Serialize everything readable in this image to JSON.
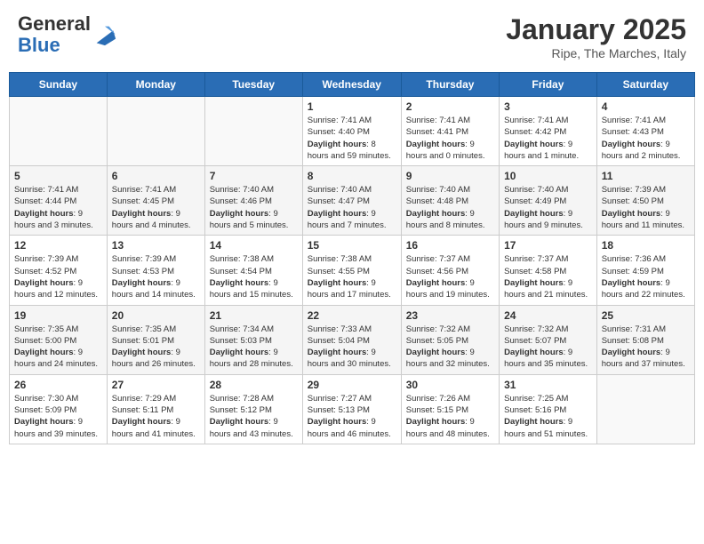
{
  "header": {
    "logo_general": "General",
    "logo_blue": "Blue",
    "month_title": "January 2025",
    "location": "Ripe, The Marches, Italy"
  },
  "days_of_week": [
    "Sunday",
    "Monday",
    "Tuesday",
    "Wednesday",
    "Thursday",
    "Friday",
    "Saturday"
  ],
  "weeks": [
    [
      {
        "day": "",
        "info": ""
      },
      {
        "day": "",
        "info": ""
      },
      {
        "day": "",
        "info": ""
      },
      {
        "day": "1",
        "info": "Sunrise: 7:41 AM\nSunset: 4:40 PM\nDaylight: 8 hours and 59 minutes."
      },
      {
        "day": "2",
        "info": "Sunrise: 7:41 AM\nSunset: 4:41 PM\nDaylight: 9 hours and 0 minutes."
      },
      {
        "day": "3",
        "info": "Sunrise: 7:41 AM\nSunset: 4:42 PM\nDaylight: 9 hours and 1 minute."
      },
      {
        "day": "4",
        "info": "Sunrise: 7:41 AM\nSunset: 4:43 PM\nDaylight: 9 hours and 2 minutes."
      }
    ],
    [
      {
        "day": "5",
        "info": "Sunrise: 7:41 AM\nSunset: 4:44 PM\nDaylight: 9 hours and 3 minutes."
      },
      {
        "day": "6",
        "info": "Sunrise: 7:41 AM\nSunset: 4:45 PM\nDaylight: 9 hours and 4 minutes."
      },
      {
        "day": "7",
        "info": "Sunrise: 7:40 AM\nSunset: 4:46 PM\nDaylight: 9 hours and 5 minutes."
      },
      {
        "day": "8",
        "info": "Sunrise: 7:40 AM\nSunset: 4:47 PM\nDaylight: 9 hours and 7 minutes."
      },
      {
        "day": "9",
        "info": "Sunrise: 7:40 AM\nSunset: 4:48 PM\nDaylight: 9 hours and 8 minutes."
      },
      {
        "day": "10",
        "info": "Sunrise: 7:40 AM\nSunset: 4:49 PM\nDaylight: 9 hours and 9 minutes."
      },
      {
        "day": "11",
        "info": "Sunrise: 7:39 AM\nSunset: 4:50 PM\nDaylight: 9 hours and 11 minutes."
      }
    ],
    [
      {
        "day": "12",
        "info": "Sunrise: 7:39 AM\nSunset: 4:52 PM\nDaylight: 9 hours and 12 minutes."
      },
      {
        "day": "13",
        "info": "Sunrise: 7:39 AM\nSunset: 4:53 PM\nDaylight: 9 hours and 14 minutes."
      },
      {
        "day": "14",
        "info": "Sunrise: 7:38 AM\nSunset: 4:54 PM\nDaylight: 9 hours and 15 minutes."
      },
      {
        "day": "15",
        "info": "Sunrise: 7:38 AM\nSunset: 4:55 PM\nDaylight: 9 hours and 17 minutes."
      },
      {
        "day": "16",
        "info": "Sunrise: 7:37 AM\nSunset: 4:56 PM\nDaylight: 9 hours and 19 minutes."
      },
      {
        "day": "17",
        "info": "Sunrise: 7:37 AM\nSunset: 4:58 PM\nDaylight: 9 hours and 21 minutes."
      },
      {
        "day": "18",
        "info": "Sunrise: 7:36 AM\nSunset: 4:59 PM\nDaylight: 9 hours and 22 minutes."
      }
    ],
    [
      {
        "day": "19",
        "info": "Sunrise: 7:35 AM\nSunset: 5:00 PM\nDaylight: 9 hours and 24 minutes."
      },
      {
        "day": "20",
        "info": "Sunrise: 7:35 AM\nSunset: 5:01 PM\nDaylight: 9 hours and 26 minutes."
      },
      {
        "day": "21",
        "info": "Sunrise: 7:34 AM\nSunset: 5:03 PM\nDaylight: 9 hours and 28 minutes."
      },
      {
        "day": "22",
        "info": "Sunrise: 7:33 AM\nSunset: 5:04 PM\nDaylight: 9 hours and 30 minutes."
      },
      {
        "day": "23",
        "info": "Sunrise: 7:32 AM\nSunset: 5:05 PM\nDaylight: 9 hours and 32 minutes."
      },
      {
        "day": "24",
        "info": "Sunrise: 7:32 AM\nSunset: 5:07 PM\nDaylight: 9 hours and 35 minutes."
      },
      {
        "day": "25",
        "info": "Sunrise: 7:31 AM\nSunset: 5:08 PM\nDaylight: 9 hours and 37 minutes."
      }
    ],
    [
      {
        "day": "26",
        "info": "Sunrise: 7:30 AM\nSunset: 5:09 PM\nDaylight: 9 hours and 39 minutes."
      },
      {
        "day": "27",
        "info": "Sunrise: 7:29 AM\nSunset: 5:11 PM\nDaylight: 9 hours and 41 minutes."
      },
      {
        "day": "28",
        "info": "Sunrise: 7:28 AM\nSunset: 5:12 PM\nDaylight: 9 hours and 43 minutes."
      },
      {
        "day": "29",
        "info": "Sunrise: 7:27 AM\nSunset: 5:13 PM\nDaylight: 9 hours and 46 minutes."
      },
      {
        "day": "30",
        "info": "Sunrise: 7:26 AM\nSunset: 5:15 PM\nDaylight: 9 hours and 48 minutes."
      },
      {
        "day": "31",
        "info": "Sunrise: 7:25 AM\nSunset: 5:16 PM\nDaylight: 9 hours and 51 minutes."
      },
      {
        "day": "",
        "info": ""
      }
    ]
  ]
}
